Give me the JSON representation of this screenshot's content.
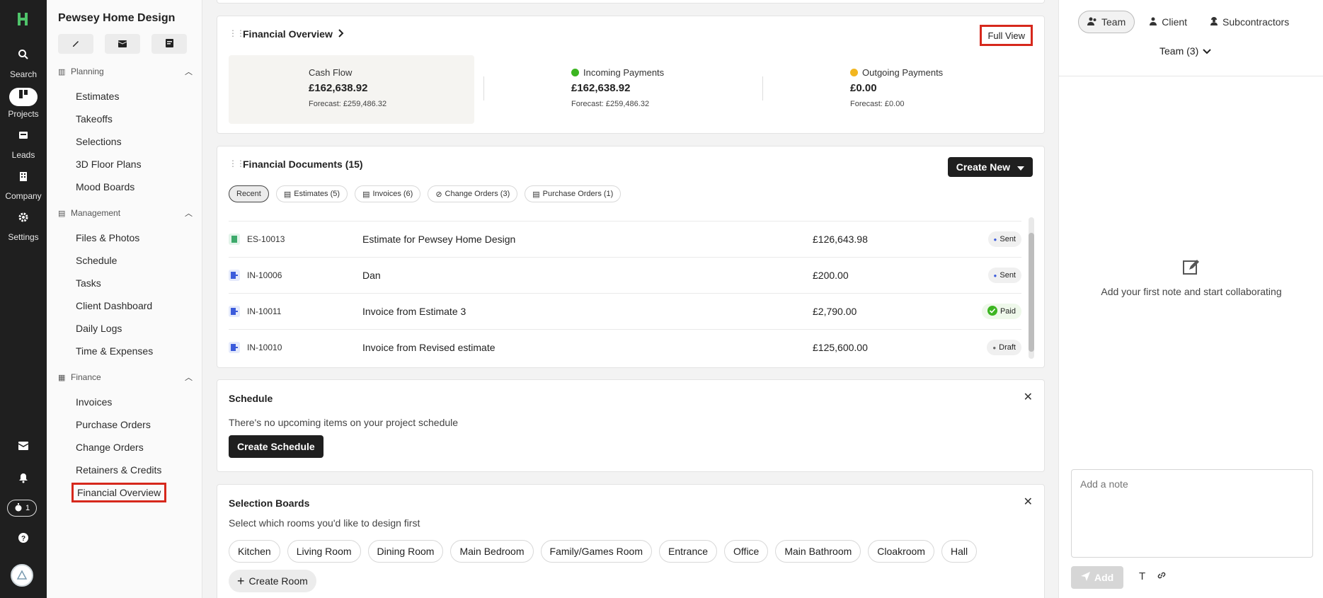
{
  "rail": {
    "items": [
      {
        "label": "Search",
        "icon": "search-icon"
      },
      {
        "label": "Projects",
        "icon": "projects-icon"
      },
      {
        "label": "Leads",
        "icon": "leads-icon"
      },
      {
        "label": "Company",
        "icon": "company-icon"
      },
      {
        "label": "Settings",
        "icon": "gear-icon"
      }
    ],
    "timer_count": "1"
  },
  "project": {
    "title": "Pewsey Home Design",
    "sections": [
      {
        "title": "Planning",
        "items": [
          "Estimates",
          "Takeoffs",
          "Selections",
          "3D Floor Plans",
          "Mood Boards"
        ]
      },
      {
        "title": "Management",
        "items": [
          "Files & Photos",
          "Schedule",
          "Tasks",
          "Client Dashboard",
          "Daily Logs",
          "Time & Expenses"
        ]
      },
      {
        "title": "Finance",
        "items": [
          "Invoices",
          "Purchase Orders",
          "Change Orders",
          "Retainers & Credits",
          "Financial Overview"
        ]
      }
    ]
  },
  "financial_overview": {
    "title": "Financial Overview",
    "full_view": "Full View",
    "cash_flow": {
      "label": "Cash Flow",
      "amount": "£162,638.92",
      "forecast": "Forecast: £259,486.32"
    },
    "incoming": {
      "label": "Incoming Payments",
      "amount": "£162,638.92",
      "forecast": "Forecast: £259,486.32",
      "color": "#3cb521"
    },
    "outgoing": {
      "label": "Outgoing Payments",
      "amount": "£0.00",
      "forecast": "Forecast: £0.00",
      "color": "#f2b620"
    }
  },
  "documents": {
    "title": "Financial Documents (15)",
    "create_new": "Create New",
    "filters": [
      "Recent",
      "Estimates (5)",
      "Invoices (6)",
      "Change Orders (3)",
      "Purchase Orders (1)"
    ],
    "rows": [
      {
        "type": "estimate",
        "number": "ES-10013",
        "name": "Estimate for Pewsey Home Design",
        "amount": "£126,643.98",
        "status": "Sent"
      },
      {
        "type": "invoice",
        "number": "IN-10006",
        "name": "Dan",
        "amount": "£200.00",
        "status": "Sent"
      },
      {
        "type": "invoice",
        "number": "IN-10011",
        "name": "Invoice from Estimate 3",
        "amount": "£2,790.00",
        "status": "Paid"
      },
      {
        "type": "invoice",
        "number": "IN-10010",
        "name": "Invoice from Revised estimate",
        "amount": "£125,600.00",
        "status": "Draft"
      }
    ]
  },
  "schedule": {
    "title": "Schedule",
    "empty_text": "There's no upcoming items on your project schedule",
    "button": "Create Schedule"
  },
  "selection_boards": {
    "title": "Selection Boards",
    "subtitle": "Select which rooms you'd like to design first",
    "rooms": [
      "Kitchen",
      "Living Room",
      "Dining Room",
      "Main Bedroom",
      "Family/Games Room",
      "Entrance",
      "Office",
      "Main Bathroom",
      "Cloakroom",
      "Hall"
    ],
    "create_room": "Create Room"
  },
  "notes_panel": {
    "tabs": [
      "Team",
      "Client",
      "Subcontractors"
    ],
    "team_select": "Team (3)",
    "empty_text": "Add your first note and start collaborating",
    "placeholder": "Add a note",
    "add_button": "Add"
  },
  "colors": {
    "accent": "#1f1f1f",
    "highlight": "#d6281c",
    "estimate_icon": "#3daa6b",
    "invoice_icon": "#3b5bdb",
    "paid": "#3cb521"
  }
}
